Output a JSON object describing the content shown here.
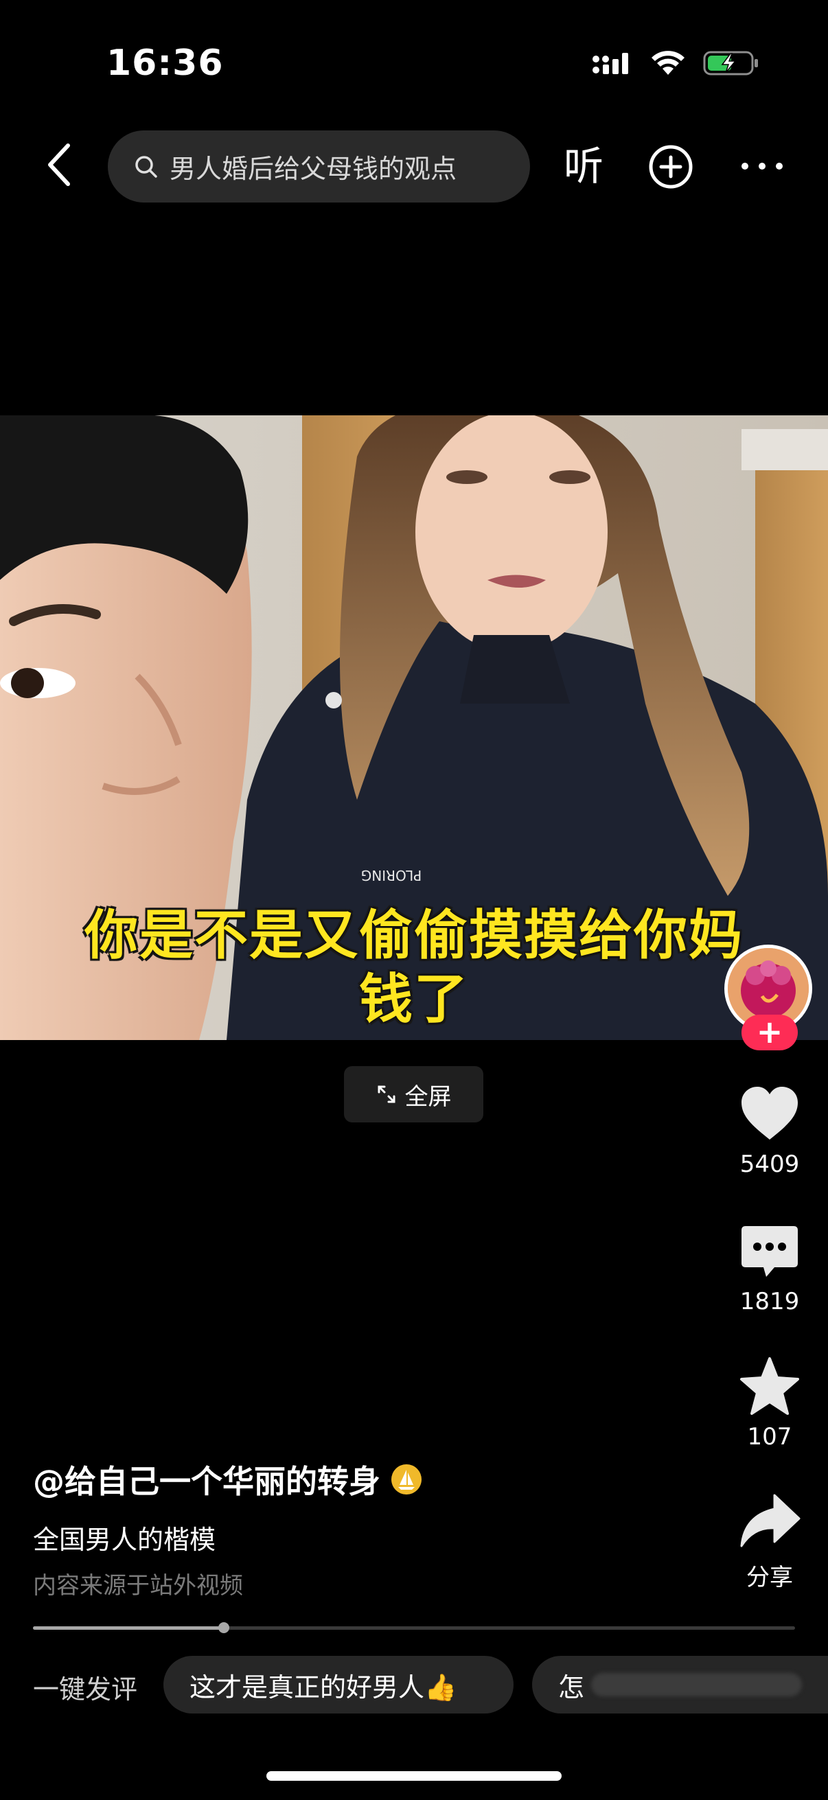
{
  "status_bar": {
    "time": "16:36",
    "icons": [
      "cellular-signal-icon",
      "wifi-icon",
      "battery-charging-icon"
    ],
    "battery_color": "#34c759"
  },
  "header": {
    "back_icon": "chevron-left-icon",
    "search_placeholder": "男人婚后给父母钱的观点",
    "listen_label": "听",
    "add_icon": "plus-circle-icon",
    "more_icon": "more-dots-icon"
  },
  "video": {
    "subtitle_line1": "你是不是又偷偷摸摸给你妈",
    "subtitle_line2": "钱了",
    "subtitle_color": "#ffe620",
    "fullscreen_label": "全屏",
    "progress": 0.25
  },
  "rail": {
    "follow_label": "+",
    "like_count": "5409",
    "comment_count": "1819",
    "favorite_count": "107",
    "share_label": "分享",
    "accent": "#fe2c55"
  },
  "description": {
    "author": "@给自己一个华丽的转身",
    "caption": "全国男人的楷模",
    "source_note": "内容来源于站外视频"
  },
  "quick_comment": {
    "label": "一键发评",
    "chips": [
      "这才是真正的好男人👍",
      "怎"
    ]
  }
}
